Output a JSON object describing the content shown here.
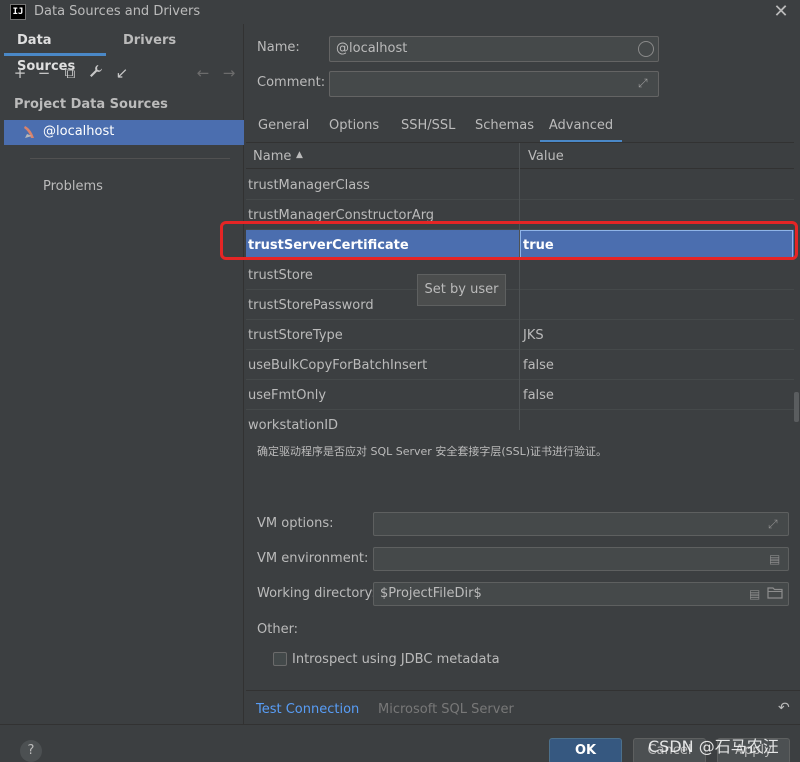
{
  "window": {
    "title": "Data Sources and Drivers",
    "app_icon": "IJ"
  },
  "left": {
    "tabs": [
      "Data Sources",
      "Drivers"
    ],
    "toolbar": {
      "add": "+",
      "remove": "−",
      "copy": "⧉",
      "settings": "🔧",
      "import": "↙",
      "back": "←",
      "forward": "→"
    },
    "section_header": "Project Data Sources",
    "selected_source": "@localhost",
    "problems": "Problems",
    "help": "?"
  },
  "form": {
    "name_label": "Name:",
    "name_value": "@localhost",
    "comment_label": "Comment:",
    "comment_value": ""
  },
  "tabs": [
    "General",
    "Options",
    "SSH/SSL",
    "Schemas",
    "Advanced"
  ],
  "active_tab": "Advanced",
  "table": {
    "columns": [
      "Name",
      "Value"
    ],
    "sort_indicator": "▲",
    "rows": [
      {
        "name": "trustManagerClass",
        "value": ""
      },
      {
        "name": "trustManagerConstructorArg",
        "value": ""
      },
      {
        "name": "trustServerCertificate",
        "value": "true"
      },
      {
        "name": "trustStore",
        "value": ""
      },
      {
        "name": "trustStorePassword",
        "value": ""
      },
      {
        "name": "trustStoreType",
        "value": "JKS"
      },
      {
        "name": "useBulkCopyForBatchInsert",
        "value": "false"
      },
      {
        "name": "useFmtOnly",
        "value": "false"
      },
      {
        "name": "workstationID",
        "value": ""
      }
    ],
    "selected_row": 2
  },
  "tooltip": "Set by user",
  "description": "确定驱动程序是否应对 SQL Server 安全套接字层(SSL)证书进行验证。",
  "vm": {
    "options_label": "VM options:",
    "options_value": "",
    "environment_label": "VM environment:",
    "environment_value": "",
    "workdir_label": "Working directory:",
    "workdir_value": "$ProjectFileDir$"
  },
  "other": {
    "label": "Other:",
    "introspect_label": "Introspect using JDBC metadata",
    "introspect_checked": false
  },
  "footer": {
    "test_connection": "Test Connection",
    "driver": "Microsoft SQL Server",
    "revert": "↶"
  },
  "buttons": {
    "ok": "OK",
    "cancel": "Cancel",
    "apply": "Apply"
  },
  "watermark": "CSDN @石马农汪",
  "colors": {
    "selection": "#4b6eaf",
    "accent": "#4a88c7",
    "highlight": "#e52525",
    "link": "#589df6"
  }
}
